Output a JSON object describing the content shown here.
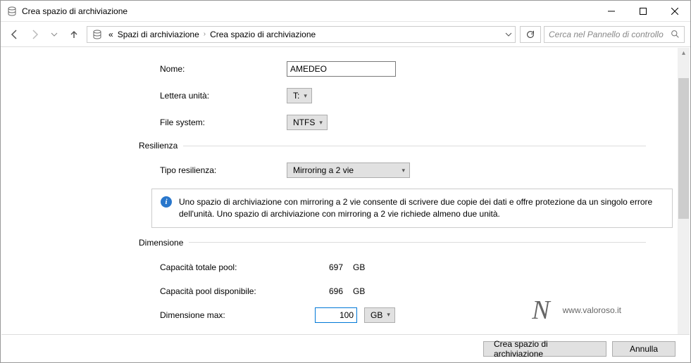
{
  "window": {
    "title": "Crea spazio di archiviazione"
  },
  "breadcrumb": {
    "prefix": "«",
    "item1": "Spazi di archiviazione",
    "item2": "Crea spazio di archiviazione"
  },
  "search": {
    "placeholder": "Cerca nel Pannello di controllo"
  },
  "form": {
    "name_label": "Nome:",
    "name_value": "AMEDEO",
    "drive_label": "Lettera unità:",
    "drive_value": "T:",
    "fs_label": "File system:",
    "fs_value": "NTFS"
  },
  "resiliency": {
    "section": "Resilienza",
    "type_label": "Tipo resilienza:",
    "type_value": "Mirroring a 2 vie",
    "info": "Uno spazio di archiviazione con mirroring a 2 vie consente di scrivere due copie dei dati e offre protezione da un singolo errore dell'unità. Uno spazio di archiviazione con mirroring a 2 vie richiede almeno due unità."
  },
  "dimension": {
    "section": "Dimensione",
    "total_label": "Capacità totale pool:",
    "total_value": "697",
    "total_unit": "GB",
    "avail_label": "Capacità pool disponibile:",
    "avail_value": "696",
    "avail_unit": "GB",
    "max_label": "Dimensione max:",
    "max_value": "100",
    "max_unit": "GB"
  },
  "footer": {
    "create": "Crea spazio di archiviazione",
    "cancel": "Annulla"
  },
  "watermark": {
    "text": "www.valoroso.it",
    "icon": "N"
  }
}
